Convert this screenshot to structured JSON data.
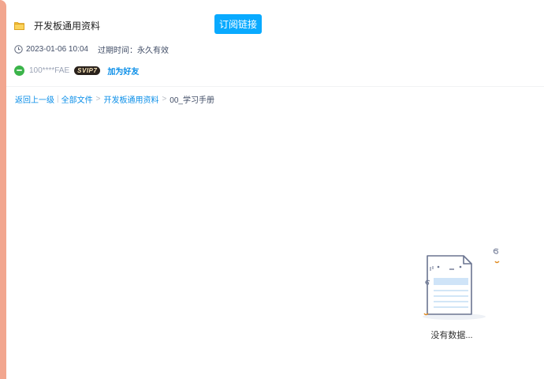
{
  "share": {
    "title": "开发板通用资料",
    "subscribe_label": "订阅链接"
  },
  "meta": {
    "created": "2023-01-06 10:04",
    "expire_label": "过期时间：",
    "expire_value": "永久有效",
    "clock_icon": "clock-icon"
  },
  "owner": {
    "name": "100****FAE",
    "vip_badge": "SVIP7",
    "add_friend_label": "加为好友"
  },
  "breadcrumb": {
    "back": "返回上一级",
    "all_files": "全部文件",
    "folder": "开发板通用资料",
    "current": "00_学习手册",
    "sep_bar": "|",
    "sep_arrow": ">"
  },
  "empty_state": {
    "text": "没有数据..."
  },
  "colors": {
    "accent": "#09aaff",
    "link": "#0a8ee8",
    "left_bar": "#f2a68f"
  }
}
